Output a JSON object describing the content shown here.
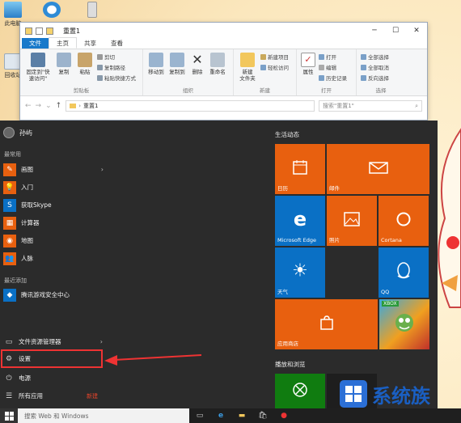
{
  "desktop": {
    "icons": [
      {
        "name": "computer-icon",
        "label": "此电脑"
      },
      {
        "name": "recycle-bin-icon",
        "label": "回收站"
      }
    ]
  },
  "explorer": {
    "title": "重置1",
    "tabs": [
      "文件",
      "主页",
      "共享",
      "查看"
    ],
    "ribbon": {
      "clipboard": {
        "pin": "固定到\"快速访问\"",
        "copy": "复制",
        "paste": "粘贴",
        "cut": "剪切",
        "copy_path": "复制路径",
        "paste_shortcut": "粘贴快捷方式",
        "group": "剪贴板"
      },
      "organize": {
        "move_to": "移动到",
        "copy_to": "复制到",
        "delete": "删除",
        "rename": "重命名",
        "group": "组织"
      },
      "new": {
        "new_folder": "新建\n文件夹",
        "new_item": "新建项目",
        "easy_access": "轻松访问",
        "group": "新建"
      },
      "open": {
        "properties": "属性",
        "open": "打开",
        "edit": "编辑",
        "history": "历史记录",
        "group": "打开"
      },
      "select": {
        "select_all": "全部选择",
        "select_none": "全部取消",
        "invert": "反向选择",
        "group": "选择"
      }
    },
    "address": "重置1",
    "search_placeholder": "搜索\"重置1\""
  },
  "start_menu": {
    "user": "孙屿",
    "most_used_heading": "最常用",
    "most_used": [
      {
        "label": "画图",
        "icon": "paint-icon",
        "color": "#e8600f",
        "has_arrow": true
      },
      {
        "label": "入门",
        "icon": "tips-icon",
        "color": "#e8600f",
        "has_arrow": false
      },
      {
        "label": "获取Skype",
        "icon": "skype-icon",
        "color": "#0a70c5",
        "has_arrow": false
      },
      {
        "label": "计算器",
        "icon": "calculator-icon",
        "color": "#e8600f",
        "has_arrow": false
      },
      {
        "label": "地图",
        "icon": "maps-icon",
        "color": "#e8600f",
        "has_arrow": false
      },
      {
        "label": "人脉",
        "icon": "people-icon",
        "color": "#e8600f",
        "has_arrow": false
      }
    ],
    "recent_heading": "最近添加",
    "recent": [
      {
        "label": "腾讯游戏安全中心",
        "icon": "tencent-game-icon",
        "color": "#0a70c5"
      }
    ],
    "system": {
      "explorer": "文件资源管理器",
      "settings": "设置",
      "power": "电源",
      "all_apps": "所有应用",
      "new_badge": "新建"
    },
    "tiles_heading": "生活动态",
    "tiles": [
      {
        "label": "日历",
        "icon": "calendar-icon",
        "color": "#e8600f"
      },
      {
        "label": "邮件",
        "icon": "mail-icon",
        "color": "#e8600f"
      },
      {
        "label": "Microsoft Edge",
        "icon": "edge-icon",
        "color": "#0a70c5"
      },
      {
        "label": "照片",
        "icon": "photos-icon",
        "color": "#e8600f"
      },
      {
        "label": "Cortana",
        "icon": "cortana-icon",
        "color": "#e8600f"
      },
      {
        "label": "天气",
        "icon": "weather-icon",
        "color": "#0a70c5"
      },
      {
        "label": "QQ",
        "icon": "qq-icon",
        "color": "#0a70c5"
      },
      {
        "label": "应用商店",
        "icon": "store-icon",
        "color": "#e8600f"
      },
      {
        "label": "XBOX",
        "icon": "xbox-game-icon",
        "color": "#2a9a3a"
      }
    ],
    "play_heading": "播放和浏览"
  },
  "taskbar": {
    "search_placeholder": "搜索 Web 和 Windows"
  },
  "watermark": "系统族"
}
